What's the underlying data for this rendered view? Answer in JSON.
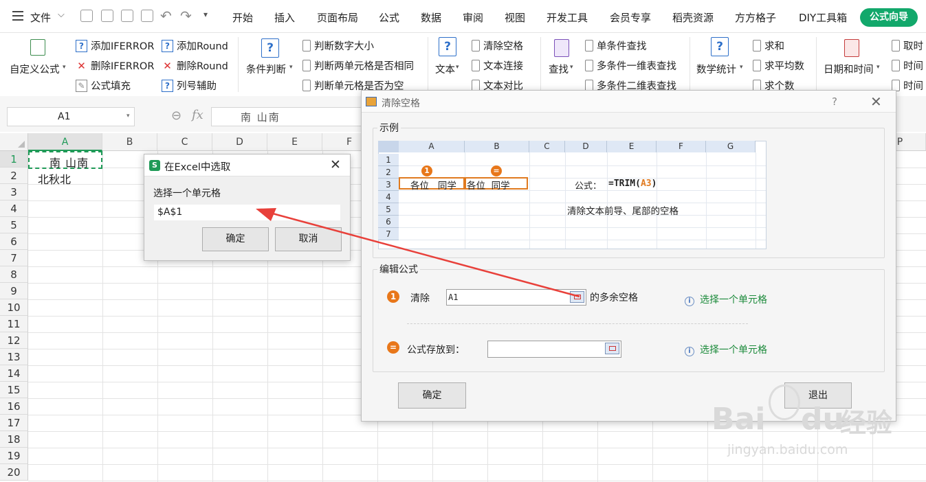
{
  "menubar": {
    "file": "文件",
    "tabs": [
      "开始",
      "插入",
      "页面布局",
      "公式",
      "数据",
      "审阅",
      "视图",
      "开发工具",
      "会员专享",
      "稻壳资源",
      "方方格子",
      "DIY工具箱"
    ],
    "active_tab": "公式向导"
  },
  "ribbon": {
    "custom_formula": "自定义公式",
    "add_iferror": "添加IFERROR",
    "del_iferror": "删除IFERROR",
    "formula_fill": "公式填充",
    "add_round": "添加Round",
    "del_round": "删除Round",
    "col_helper": "列号辅助",
    "cond_judge": "条件判断",
    "judge_num": "判断数字大小",
    "judge_same": "判断两单元格是否相同",
    "judge_empty": "判断单元格是否为空",
    "text": "文本",
    "clear_space": "清除空格",
    "text_concat": "文本连接",
    "text_compare": "文本对比",
    "find": "查找",
    "single_lookup": "单条件查找",
    "multi_1d": "多条件一维表查找",
    "multi_2d": "多条件二维表查找",
    "math_stats": "数学统计",
    "sum": "求和",
    "avg": "求平均数",
    "count": "求个数",
    "datetime": "日期和时间",
    "take_time": "取时",
    "time1": "时间",
    "time2": "时间"
  },
  "formula_bar": {
    "cell_ref": "A1",
    "content": "南 山南"
  },
  "sheet": {
    "columns": [
      "A",
      "B",
      "C",
      "D",
      "E",
      "F",
      "P"
    ],
    "rows": [
      "1",
      "2",
      "3",
      "4",
      "5",
      "6",
      "7",
      "8",
      "9",
      "10",
      "11",
      "12",
      "13",
      "14",
      "15",
      "16",
      "17",
      "18",
      "19",
      "20"
    ],
    "a1": "南 山南",
    "a2": "北秋北"
  },
  "pick_dialog": {
    "title": "在Excel中选取",
    "prompt": "选择一个单元格",
    "value": "$A$1",
    "ok": "确定",
    "cancel": "取消"
  },
  "main_dialog": {
    "title": "清除空格",
    "help": "?",
    "example_title": "示例",
    "example": {
      "cols": [
        "A",
        "B",
        "C",
        "D",
        "E",
        "F",
        "G"
      ],
      "rows": [
        "1",
        "2",
        "3",
        "4",
        "5",
        "6",
        "7"
      ],
      "cell_a3": "各位   同学",
      "cell_b3": "各位  同学",
      "marker1": "1",
      "marker2": "=",
      "formula_label": "公式：",
      "formula_prefix": "=TRIM(",
      "formula_ref": "A3",
      "formula_suffix": ")",
      "desc": "清除文本前导、尾部的空格"
    },
    "edit_title": "编辑公式",
    "step1_label": "清除",
    "step1_value": "A1",
    "step1_suffix": "的多余空格",
    "step1_hint": "选择一个单元格",
    "step2_label": "公式存放到：",
    "step2_value": "",
    "step2_hint": "选择一个单元格",
    "ok": "确定",
    "exit": "退出"
  },
  "watermark": {
    "brand": "Bai",
    "brand2": "du",
    "cn": "经验",
    "url": "jingyan.baidu.com"
  }
}
